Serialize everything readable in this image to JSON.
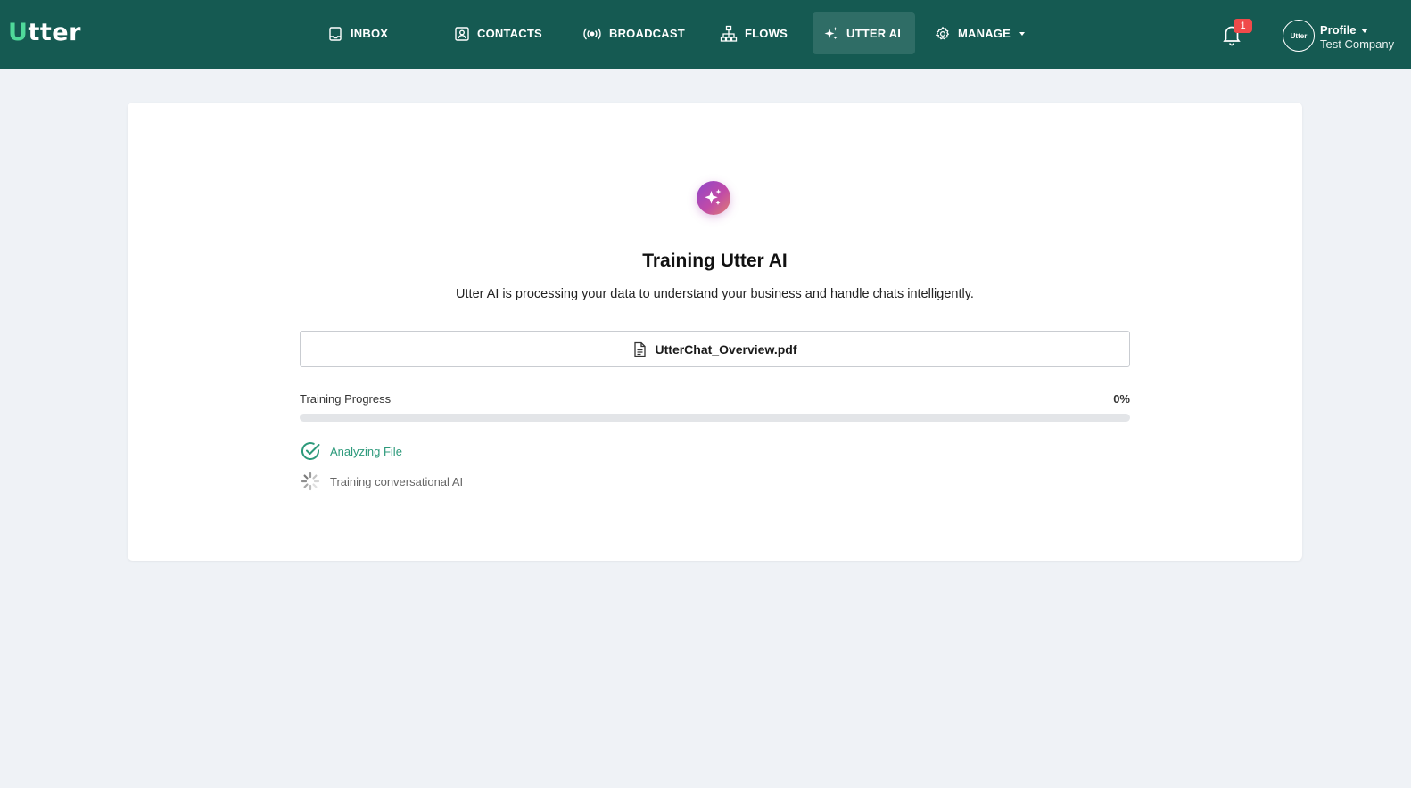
{
  "brand": {
    "logo_first": "U",
    "logo_rest": "tter",
    "accent": "#4fd99a",
    "nav_bg": "#155a52"
  },
  "nav": {
    "inbox": "INBOX",
    "contacts": "CONTACTS",
    "broadcast": "BROADCAST",
    "flows": "FLOWS",
    "utter_ai": "UTTER AI",
    "manage": "MANAGE",
    "active": "utter_ai"
  },
  "header_right": {
    "notification_count": "1",
    "avatar_text": "Utter",
    "profile_label": "Profile",
    "company": "Test Company"
  },
  "training": {
    "icon": "sparkles-icon",
    "title": "Training Utter AI",
    "description": "Utter AI is processing your data to understand your business and handle chats intelligently.",
    "file_name": "UtterChat_Overview.pdf",
    "progress_label": "Training Progress",
    "progress_text": "0%",
    "progress_value": 0,
    "steps": [
      {
        "label": "Analyzing File",
        "status": "done",
        "color": "#2d9a7b"
      },
      {
        "label": "Training conversational AI",
        "status": "in-progress",
        "color": "#666666"
      }
    ]
  }
}
